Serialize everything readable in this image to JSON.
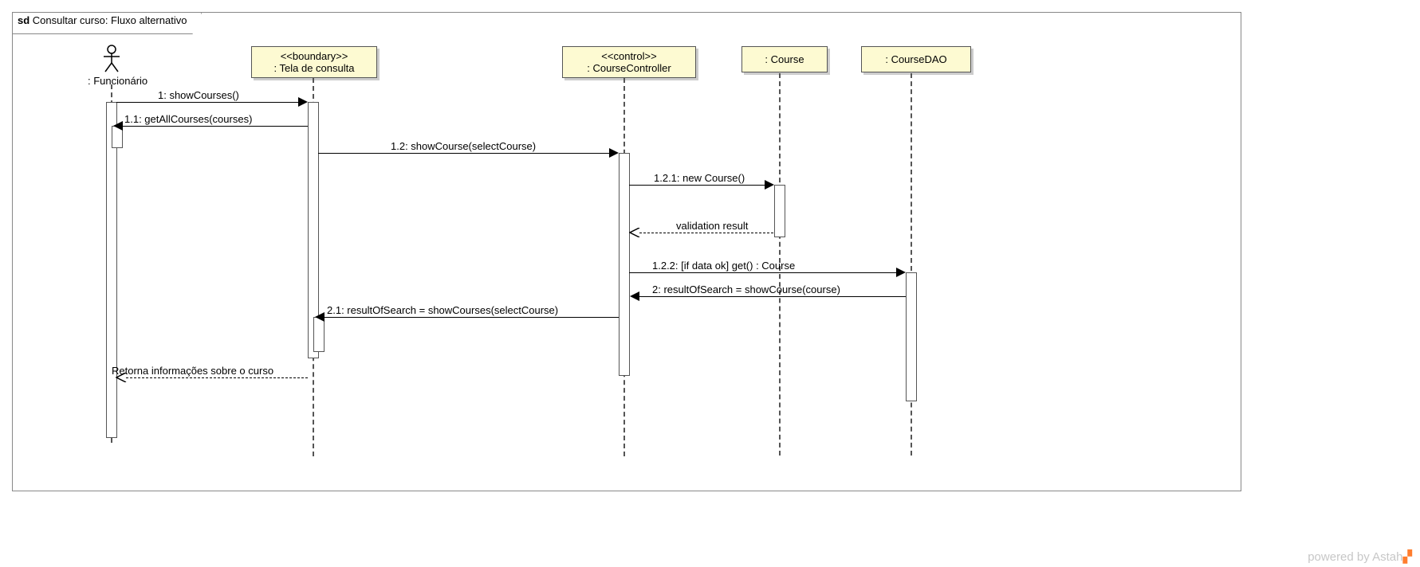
{
  "frame": {
    "tag": "sd",
    "title": "Consultar curso: Fluxo alternativo"
  },
  "participants": {
    "actor": {
      "name": ": Funcionário"
    },
    "boundary": {
      "stereotype": "<<boundary>>",
      "name": ": Tela de consulta"
    },
    "control": {
      "stereotype": "<<control>>",
      "name": ": CourseController"
    },
    "course": {
      "name": ": Course"
    },
    "dao": {
      "name": ": CourseDAO"
    }
  },
  "messages": {
    "m1": "1: showCourses()",
    "m11": "1.1: getAllCourses(courses)",
    "m12": "1.2: showCourse(selectCourse)",
    "m121": "1.2.1: new Course()",
    "m121r": "validation result",
    "m122": "1.2.2: [if data ok] get() : Course",
    "m2": "2: resultOfSearch = showCourse(course)",
    "m21": "2.1: resultOfSearch = showCourses(selectCourse)",
    "mret": "Retorna informações sobre o curso"
  },
  "footer": {
    "text": "powered by  Astah",
    "logo": "▞"
  }
}
